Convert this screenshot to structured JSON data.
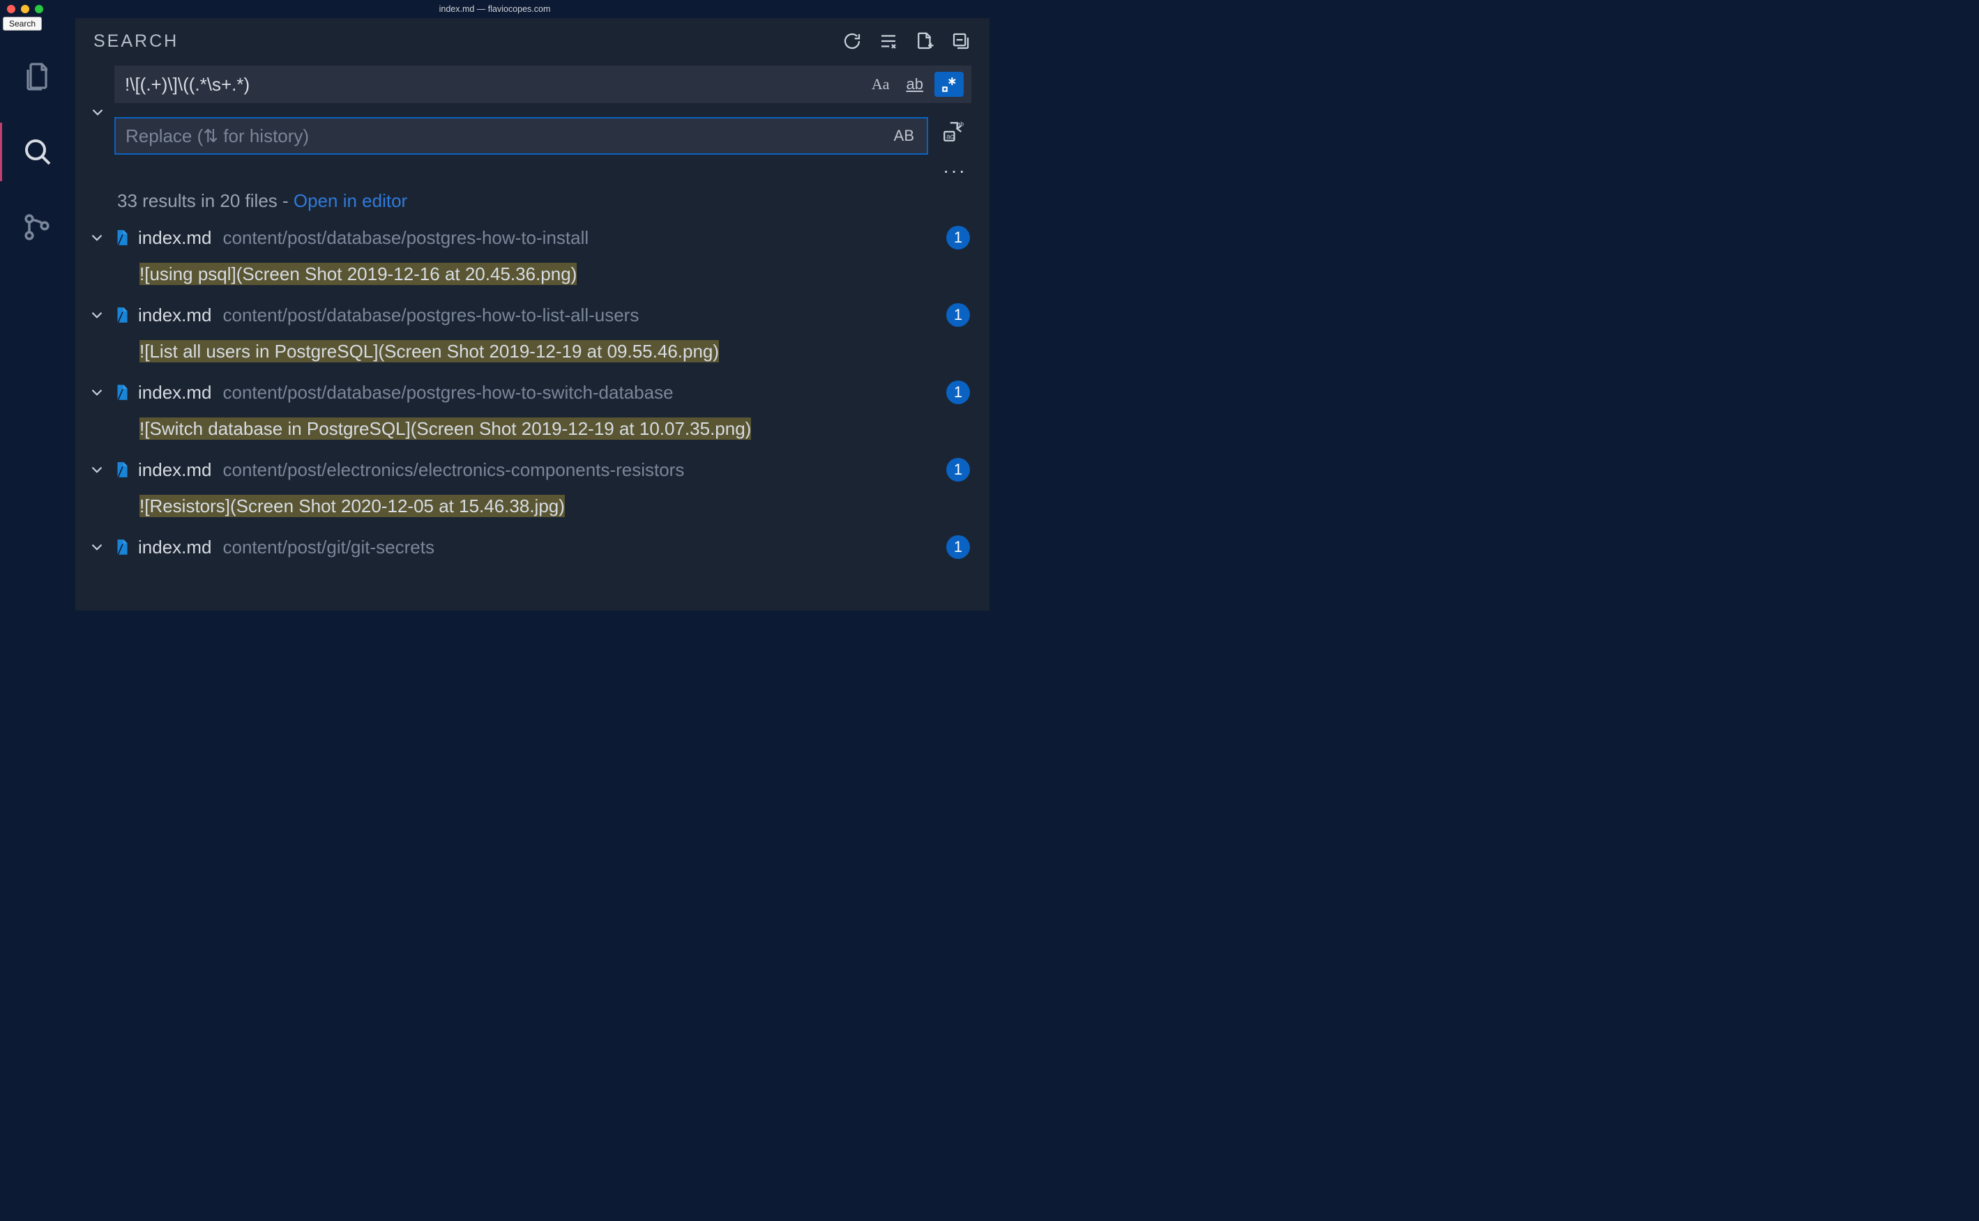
{
  "titlebar": {
    "title": "index.md — flaviocopes.com",
    "tooltip": "Search"
  },
  "activity": {
    "items": [
      {
        "name": "explorer-icon"
      },
      {
        "name": "search-icon"
      },
      {
        "name": "source-control-icon"
      }
    ],
    "active_index": 1
  },
  "sidebar": {
    "title": "SEARCH"
  },
  "search": {
    "query": "!\\[(.+)\\]\\((.*\\s+.*)",
    "replace_placeholder": "Replace (⇅ for history)",
    "replace_value": "",
    "match_case_active": false,
    "whole_word_active": false,
    "regex_active": true,
    "preserve_case_label": "AB"
  },
  "summary": {
    "text": "33 results in 20 files - ",
    "link": "Open in editor"
  },
  "results": [
    {
      "filename": "index.md",
      "path": "content/post/database/postgres-how-to-install",
      "count": 1,
      "match": "![using psql](Screen Shot 2019-12-16 at 20.45.36.png)"
    },
    {
      "filename": "index.md",
      "path": "content/post/database/postgres-how-to-list-all-users",
      "count": 1,
      "match": "![List all users in PostgreSQL](Screen Shot 2019-12-19 at 09.55.46.png)"
    },
    {
      "filename": "index.md",
      "path": "content/post/database/postgres-how-to-switch-database",
      "count": 1,
      "match": "![Switch database in PostgreSQL](Screen Shot 2019-12-19 at 10.07.35.png)"
    },
    {
      "filename": "index.md",
      "path": "content/post/electronics/electronics-components-resistors",
      "count": 1,
      "match": "![Resistors](Screen Shot 2020-12-05 at 15.46.38.jpg)"
    },
    {
      "filename": "index.md",
      "path": "content/post/git/git-secrets",
      "count": 1,
      "match": ""
    }
  ]
}
